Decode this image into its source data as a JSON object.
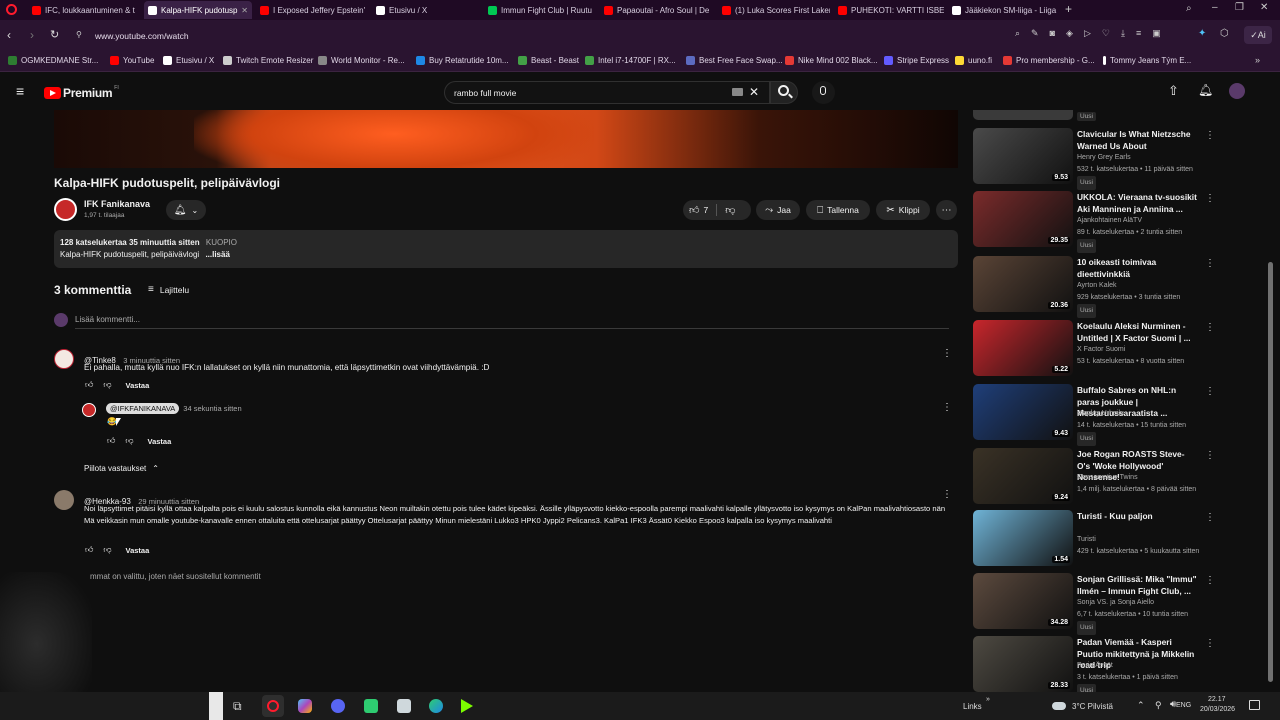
{
  "browser": {
    "tabs": [
      {
        "label": "IFC, loukkaantuminen & t",
        "color": "#ff0000"
      },
      {
        "label": "Kalpa-HIFK pudotusp",
        "color": "#ffffff"
      },
      {
        "label": "I Exposed Jeffery Epstein'",
        "color": "#ff0000"
      },
      {
        "label": "Etusivu / X",
        "color": "#ffffff"
      },
      {
        "label": "Immun Fight Club | Ruutu",
        "color": "#00c853"
      },
      {
        "label": "Papaoutai - Afro Soul | De",
        "color": "#ff0000"
      },
      {
        "label": "(1) Luka Scores First Laker",
        "color": "#ff0000"
      },
      {
        "label": "PUHEKOTI: VARTTI ISBERG",
        "color": "#ff0000"
      },
      {
        "label": "Jääkiekon SM-liiga - Liiga",
        "color": "#ffffff"
      }
    ],
    "url": "www.youtube.com/watch",
    "bookmarks": [
      {
        "label": "OGMKEDMANE Str...",
        "color": "#2e7d32"
      },
      {
        "label": "YouTube",
        "color": "#ff0000"
      },
      {
        "label": "Etusivu / X",
        "color": "#ffffff"
      },
      {
        "label": "Twitch Emote Resizer",
        "color": "#cccccc"
      },
      {
        "label": "World Monitor - Re...",
        "color": "#888888"
      },
      {
        "label": "Buy Retatrutide 10m...",
        "color": "#1e88e5"
      },
      {
        "label": "Beast - Beast",
        "color": "#43a047"
      },
      {
        "label": "Intel i7-14700F | RX...",
        "color": "#43a047"
      },
      {
        "label": "Best Free Face Swap...",
        "color": "#5c6bc0"
      },
      {
        "label": "Nike Mind 002 Black...",
        "color": "#e53935"
      },
      {
        "label": "Stripe Express",
        "color": "#635bff"
      },
      {
        "label": "uuno.fi",
        "color": "#fdd835"
      },
      {
        "label": "Pro membership - G...",
        "color": "#e53935"
      },
      {
        "label": "Tommy Jeans Tým E...",
        "color": "#ffffff"
      }
    ]
  },
  "header": {
    "logo_text": "Premium",
    "logo_sup": "FI",
    "search_value": "rambo full movie"
  },
  "video": {
    "title": "Kalpa-HIFK pudotuspelit, pelipäivävlogi",
    "channel": "IFK Fanikanava",
    "subscribers": "1,97 t. tilaajaa",
    "like_count": "7",
    "share_label": "Jaa",
    "save_label": "Tallenna",
    "clip_label": "Klippi",
    "description_meta": "128 katselukertaa  35 minuuttia sitten",
    "description_location": "KUOPIO",
    "description_text": "Kalpa-HIFK pudotuspelit, pelipäivävlogi",
    "description_more": "...lisää"
  },
  "comments": {
    "count_label": "3 kommenttia",
    "sort_label": "Lajittelu",
    "add_placeholder": "Lisää kommentti...",
    "items": [
      {
        "author": "@Tinke8",
        "time": "3 minuuttia sitten",
        "text": "Ei pahalla, mutta kyllä nuo IFK:n lallatukset on kyllä niin munattomia, että läpsyttimetkin ovat viihdyttävämpiä. :D",
        "reply_label": "Vastaa"
      },
      {
        "author": "@IFKFANIKANAVA",
        "time": "34 sekuntia sitten",
        "text": "😂",
        "reply_label": "Vastaa"
      },
      {
        "author": "@Henkka-93",
        "time": "29 minuuttia sitten",
        "text": "Noi läpsyttimet pitäisi kyllä ottaa kalpalta pois ei kuulu salostus kunnolla eikä kannustus  Neon muiltakin otettu pois  tulee kädet kipeäksi. Ässille ylläpysvotto kiekko-espoolla parempi maalivahti kalpalle yllätysvotto iso kysymys on KalPan maalivahtiosasto nän Mä veikkasin mun omalle youtube-kanavalle ennen ottaluita että ottelusarjat päättyy Ottelusarjat päättyy Minun mielestäni Lukko3  HPK0  Jyppi2 Pelicans3. KalPa1 IFK3   Ässät0 Kiekko Espoo3 kalpalla iso kysymys maalivahti",
        "reply_label": "Vastaa"
      }
    ],
    "hide_replies": "Piilota vastaukset",
    "footer_note": "mmat on valittu, joten näet suositellut kommentit"
  },
  "recommendations": [
    {
      "title": "Clavicular Is What Nietzsche Warned Us About",
      "channel": "Henry Grey Earls",
      "meta": "532 t. katselukertaa • 11 päivää sitten",
      "badge": "Uusi",
      "duration": "9.53",
      "thumb_color": "#4a4a4a"
    },
    {
      "title": "UKKOLA: Vieraana tv-suosikit Aki Manninen ja Anniina ...",
      "channel": "Ajankohtainen AläTV",
      "meta": "89 t. katselukertaa • 2 tuntia sitten",
      "badge": "Uusi",
      "duration": "29.35",
      "thumb_color": "#7b2b2b"
    },
    {
      "title": "10 oikeasti toimivaa dieettivinkkiä",
      "channel": "Ayrton Kalek",
      "meta": "929 katselukertaa • 3 tuntia sitten",
      "badge": "Uusi",
      "duration": "20.36",
      "thumb_color": "#5a4436"
    },
    {
      "title": "Koelaulu Aleksi Nurminen - Untitled | X Factor Suomi | ...",
      "channel": "X Factor Suomi",
      "meta": "53 t. katselukertaa • 8 vuotta sitten",
      "badge": "",
      "duration": "5.22",
      "thumb_color": "#c8262c"
    },
    {
      "title": "Buffalo Sabres on NHL:n paras joukkue | Mestaruussaraatista ...",
      "channel": "Viaplay Urheilu",
      "meta": "14 t. katselukertaa • 15 tuntia sitten",
      "badge": "Uusi",
      "duration": "9.43",
      "thumb_color": "#1f3f7a"
    },
    {
      "title": "Joe Rogan ROASTS Steve-O's 'Woke Hollywood' Nonsense!",
      "channel": "Conservative Twins",
      "meta": "1,4 milj. katselukertaa • 8 päivää sitten",
      "badge": "",
      "duration": "9.24",
      "thumb_color": "#3a3226"
    },
    {
      "title": "Turisti - Kuu paljon",
      "channel": "Turisti",
      "meta": "429 t. katselukertaa • 5 kuukautta sitten",
      "badge": "",
      "duration": "1.54",
      "thumb_color": "#6fb3d6"
    },
    {
      "title": "Sonjan Grillissä: Mika \"Immu\" Ilmén – Immun Fight Club, ...",
      "channel": "Sonja VS. ja Sonja Aiello",
      "meta": "6,7 t. katselukertaa • 10 tuntia sitten",
      "badge": "Uusi",
      "duration": "34.28",
      "thumb_color": "#5c4a3e"
    },
    {
      "title": "Padan Viemää - Kasperi Puutio mikitettynä ja Mikkelin road trip",
      "channel": "Porin Ässät",
      "meta": "3 t. katselukertaa • 1 päivä sitten",
      "badge": "Uusi",
      "duration": "28.33",
      "thumb_color": "#4e4a42"
    }
  ],
  "taskbar": {
    "links_label": "Links",
    "weather": "3°C  Pilvistä",
    "lang": "ENG",
    "time": "22.17",
    "date": "20/03/2026"
  }
}
